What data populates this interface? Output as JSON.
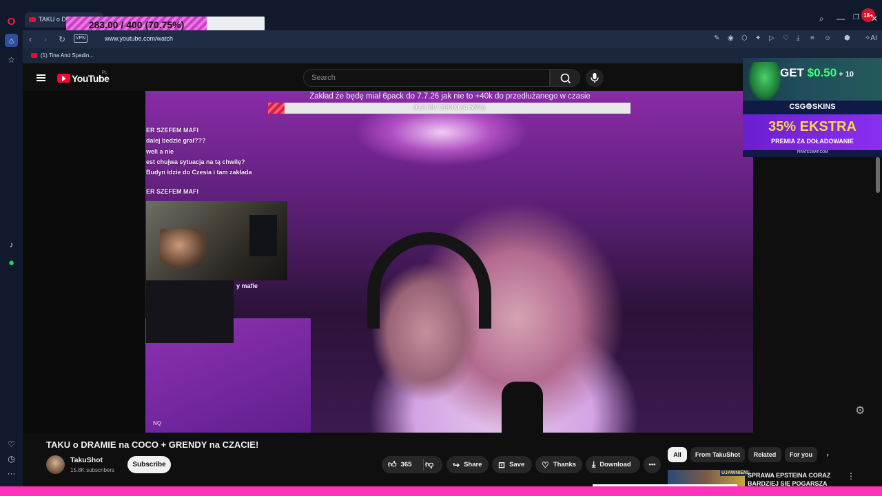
{
  "browser": {
    "tab_title": "TAKU o D",
    "overlay_progress": {
      "text": "283.00 / 400 (70.75%)",
      "fraction": 0.7075
    },
    "url": "www.youtube.com/watch",
    "vpn_label": "VPN",
    "bookmark": "(1) Tina And Spadin...",
    "notif_badge": "18+",
    "ai_label": "AI",
    "icons": {
      "opera": "opera-logo-icon",
      "home": "home-icon",
      "bookmarks": "star-icon",
      "tiktok": "tiktok-icon",
      "spotify": "spotify-icon",
      "heart": "heart-icon",
      "history": "clock-icon",
      "more": "more-icon"
    }
  },
  "youtube": {
    "logo_text": "YouTube",
    "country": "PL",
    "search_placeholder": "Search",
    "video": {
      "goal_title": "Zakład że będę miał 6pack do 7.7.26 jak nie to +40k do przedłużanego w czasie",
      "goal_text": "912.69 / 20000 (4.56%)",
      "goal_fraction": 0.0456,
      "chat_lines": [
        "ER SZEFEM MAFI",
        "dalej bedzie grał???",
        "weli a nie",
        "est chujwa sytuacja na tą chwilę?",
        "Budyn idzie do Czesia i tam zakłada",
        "ER SZEFEM MAFI"
      ],
      "chat_tail": "y mafie",
      "watermark": "NQ"
    },
    "title": "TAKU o DRAMIE na COCO + GRENDY na CZACIE!",
    "channel": {
      "name": "TakuShot",
      "subscribers": "15.8K subscribers",
      "subscribe_label": "Subscribe"
    },
    "actions": {
      "likes": "365",
      "share": "Share",
      "save": "Save",
      "thanks": "Thanks",
      "download": "Download"
    },
    "chips": [
      "All",
      "From TakuShot",
      "Related",
      "For you"
    ],
    "recommendation": {
      "title": "SPRAWA EPSTEINA CORAZ BARDZIEJ SIĘ POGARSZA",
      "thumb_tag": "UJAWNIENI"
    },
    "ad": {
      "get_prefix": "GET ",
      "get_amount": "$0.50",
      "get_suffix": " + 10",
      "brand": "CSG⚙SKINS",
      "bonus_main": "35% EKSTRA",
      "bonus_sub": "PREMIA ZA DOŁADOWANIE",
      "footer": "PIRATESWAP.COM"
    }
  },
  "colors": {
    "accent": "#ff0033",
    "browser_bg": "#101a2c",
    "strip": "#ff33bb"
  }
}
